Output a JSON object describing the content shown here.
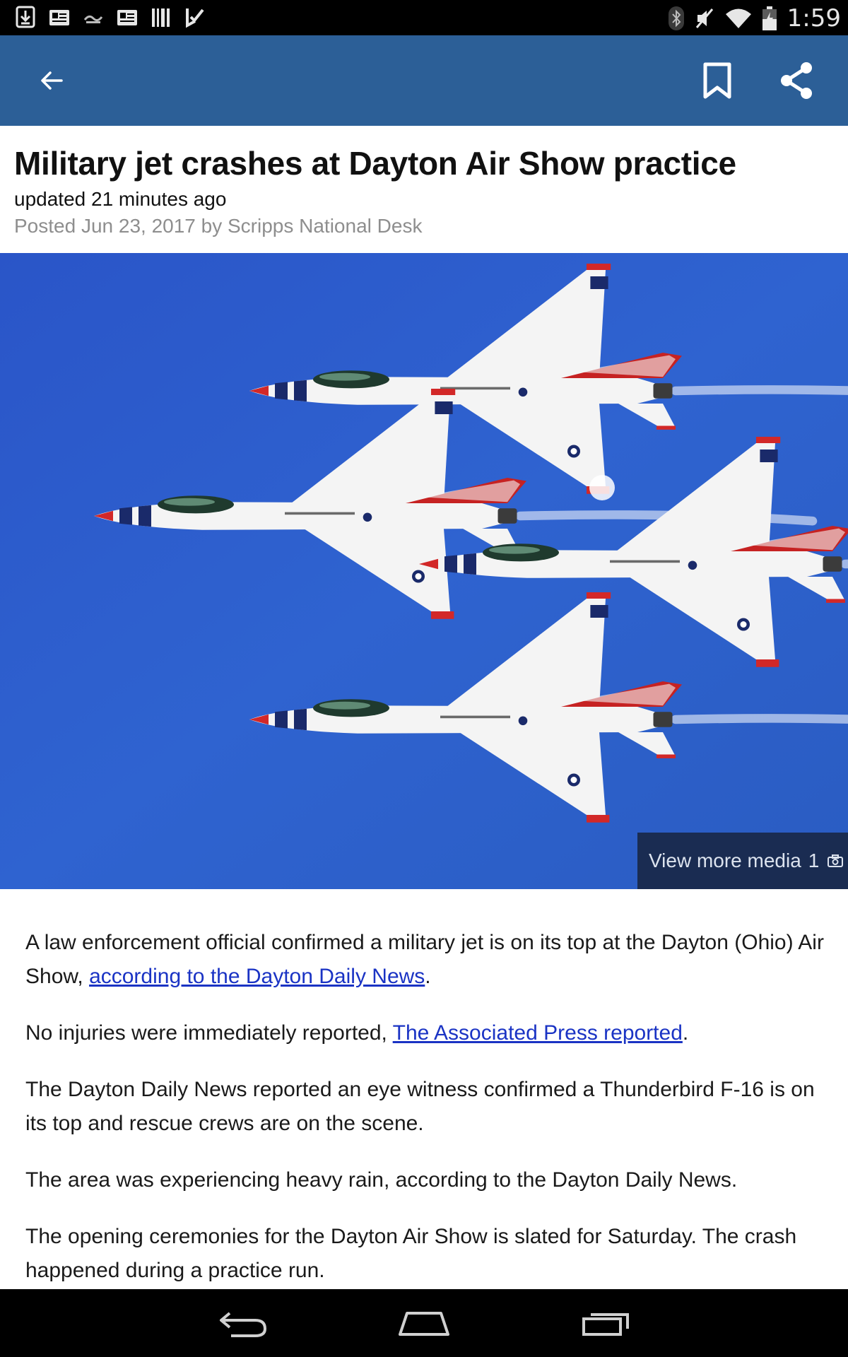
{
  "status_bar": {
    "time": "1:59",
    "left_icons": [
      "download-icon",
      "news-icon",
      "newspaper-logo-icon",
      "news-icon",
      "barcode-icon",
      "checkmark-icon"
    ],
    "right_icons": [
      "bluetooth-icon",
      "mute-icon",
      "wifi-icon",
      "battery-icon"
    ]
  },
  "app_bar": {
    "background": "#2c5f97",
    "icons": [
      "back-arrow-icon",
      "bookmark-icon",
      "share-icon"
    ]
  },
  "article": {
    "headline": "Military jet crashes at Dayton Air Show practice",
    "updated": "updated 21 minutes ago",
    "posted": "Posted Jun 23, 2017 by Scripps National Desk",
    "hero_image": {
      "description_icon": "jets-photo",
      "media_button_label": "View more media",
      "media_count": "1",
      "media_icon": "camera-icon"
    },
    "paragraphs": [
      {
        "before": "A law enforcement official confirmed a military jet is on its top at the Dayton (Ohio) Air Show, ",
        "link": "according to the Dayton Daily News",
        "after": "."
      },
      {
        "before": "No injuries were immediately reported, ",
        "link": "The Associated Press reported",
        "after": "."
      },
      {
        "text": "The Dayton Daily News reported an eye witness confirmed a Thunderbird F-16 is on its top and rescue crews are on the scene."
      },
      {
        "text": "The area was experiencing heavy rain, according to the Dayton Daily News."
      },
      {
        "text": "The opening ceremonies for the Dayton Air Show is slated for Saturday. The crash happened during a practice run."
      }
    ],
    "link_color": "#1a33c4"
  },
  "nav_bar": {
    "icons": [
      "nav-back-icon",
      "home-icon",
      "recent-apps-icon"
    ]
  }
}
